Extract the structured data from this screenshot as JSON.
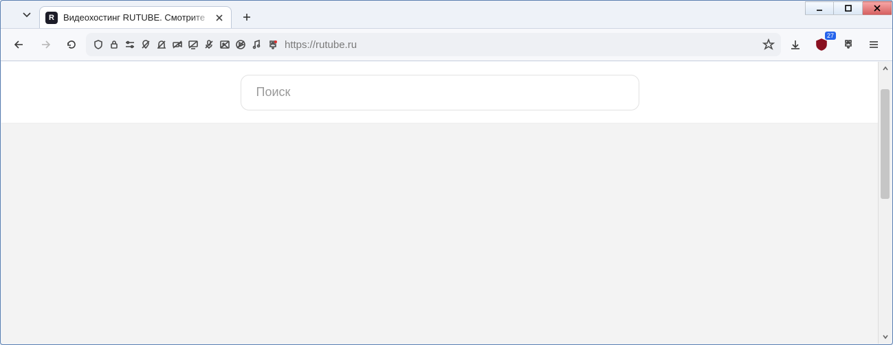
{
  "window": {
    "controls": {
      "min": "minimize",
      "max": "maximize",
      "close": "close"
    }
  },
  "tab": {
    "title": "Видеохостинг RUTUBE. Смотрите",
    "favicon_letter": "R"
  },
  "nav": {
    "url": "https://rutube.ru"
  },
  "ext_badge": "27",
  "page": {
    "search_placeholder": "Поиск"
  }
}
